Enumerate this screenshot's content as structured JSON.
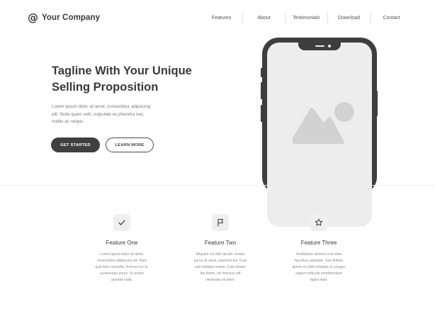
{
  "header": {
    "logo_symbol": "@",
    "logo_text": "Your Company",
    "nav": [
      "Features",
      "About",
      "Testimonials",
      "Download",
      "Contact"
    ]
  },
  "hero": {
    "title_lines": [
      "Tagline With Your Unique",
      "Selling Proposition"
    ],
    "text_lines": [
      "Lorem ipsum dolor sit amet, consectetur adipiscing",
      "elit. Nulla quam velit, vulputate eu pharetra nec,",
      "mattis ac neque."
    ],
    "primary_button": "GET STARTED",
    "secondary_button": "LEARN MORE",
    "device_image_icon": "image-placeholder-icon"
  },
  "features": [
    {
      "icon": "check-icon",
      "title": "Feature One",
      "desc_lines": [
        "Lorem ipsum dolor sit amet,",
        "consectetur adipiscing elit. Nam",
        "quis felis convallis, rhoncus leo id,",
        "scelerisque purus. Ut auctor",
        "gravida nulla."
      ]
    },
    {
      "icon": "flag-icon",
      "title": "Feature Two",
      "desc_lines": [
        "Aliquam vel nibh iaculis, ornare",
        "purus sit amet, euismod dui. Cras",
        "sed tristique neque. Cras ornare",
        "dui lorem, vel rhoncus elit",
        "venenatis sit amet."
      ]
    },
    {
      "icon": "star-icon",
      "title": "Feature Three",
      "desc_lines": [
        "Vestibulum ultricies erat vitae",
        "faucibus vulputate. Sed finibus",
        "ipsum eu nibh volutpat, in congue",
        "sapien vehicula condimentum",
        "ligula vitae."
      ]
    }
  ],
  "colors": {
    "dark": "#3e3e3e",
    "light_gray": "#ededed",
    "text": "#3a3a3a",
    "muted_text": "#7a7a7a"
  }
}
